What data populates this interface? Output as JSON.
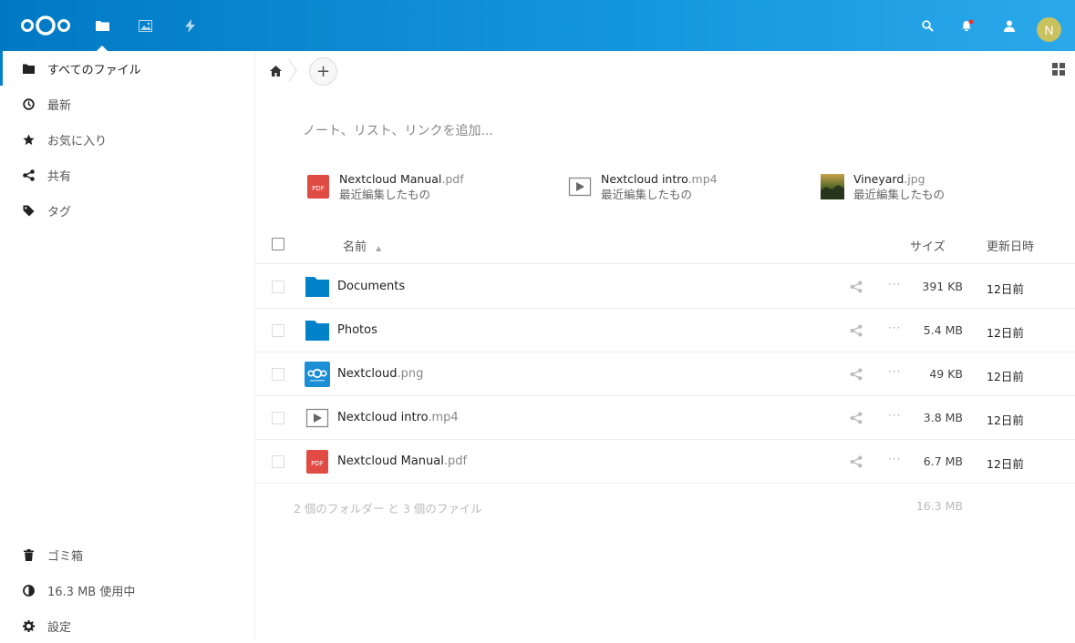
{
  "header": {
    "app_icons": [
      "files-icon",
      "gallery-icon",
      "activity-icon"
    ],
    "avatar_initial": "N",
    "brand_color": "#0082c9"
  },
  "sidebar": {
    "items": [
      {
        "label": "すべてのファイル",
        "icon": "folder-icon",
        "active": true
      },
      {
        "label": "最新",
        "icon": "clock-icon"
      },
      {
        "label": "お気に入り",
        "icon": "star-icon"
      },
      {
        "label": "共有",
        "icon": "share-icon"
      },
      {
        "label": "タグ",
        "icon": "tag-icon"
      }
    ],
    "bottom": [
      {
        "label": "ゴミ箱",
        "icon": "trash-icon"
      },
      {
        "label": "16.3 MB 使用中",
        "icon": "quota-icon"
      },
      {
        "label": "設定",
        "icon": "gear-icon"
      }
    ]
  },
  "main": {
    "add_label": "+",
    "notes_placeholder": "ノート、リスト、リンクを追加...",
    "recent": [
      {
        "base": "Nextcloud Manual",
        "ext": ".pdf",
        "sub": "最近編集したもの",
        "icon": "pdf-icon"
      },
      {
        "base": "Nextcloud intro",
        "ext": ".mp4",
        "sub": "最近編集したもの",
        "icon": "video-icon"
      },
      {
        "base": "Vineyard",
        "ext": ".jpg",
        "sub": "最近編集したもの",
        "icon": "image-thumbnail"
      }
    ],
    "columns": {
      "name": "名前",
      "sort": "▲",
      "size": "サイズ",
      "modified": "更新日時"
    },
    "files": [
      {
        "base": "Documents",
        "ext": "",
        "size": "391 KB",
        "modified": "12日前",
        "icon": "folder-icon"
      },
      {
        "base": "Photos",
        "ext": "",
        "size": "5.4 MB",
        "modified": "12日前",
        "icon": "folder-icon"
      },
      {
        "base": "Nextcloud",
        "ext": ".png",
        "size": "49 KB",
        "modified": "12日前",
        "icon": "nextcloud-image-icon"
      },
      {
        "base": "Nextcloud intro",
        "ext": ".mp4",
        "size": "3.8 MB",
        "modified": "12日前",
        "icon": "video-icon"
      },
      {
        "base": "Nextcloud Manual",
        "ext": ".pdf",
        "size": "6.7 MB",
        "modified": "12日前",
        "icon": "pdf-icon"
      }
    ],
    "more_label": "···",
    "summary": "2 個のフォルダー と 3 個のファイル",
    "summary_size": "16.3 MB"
  }
}
